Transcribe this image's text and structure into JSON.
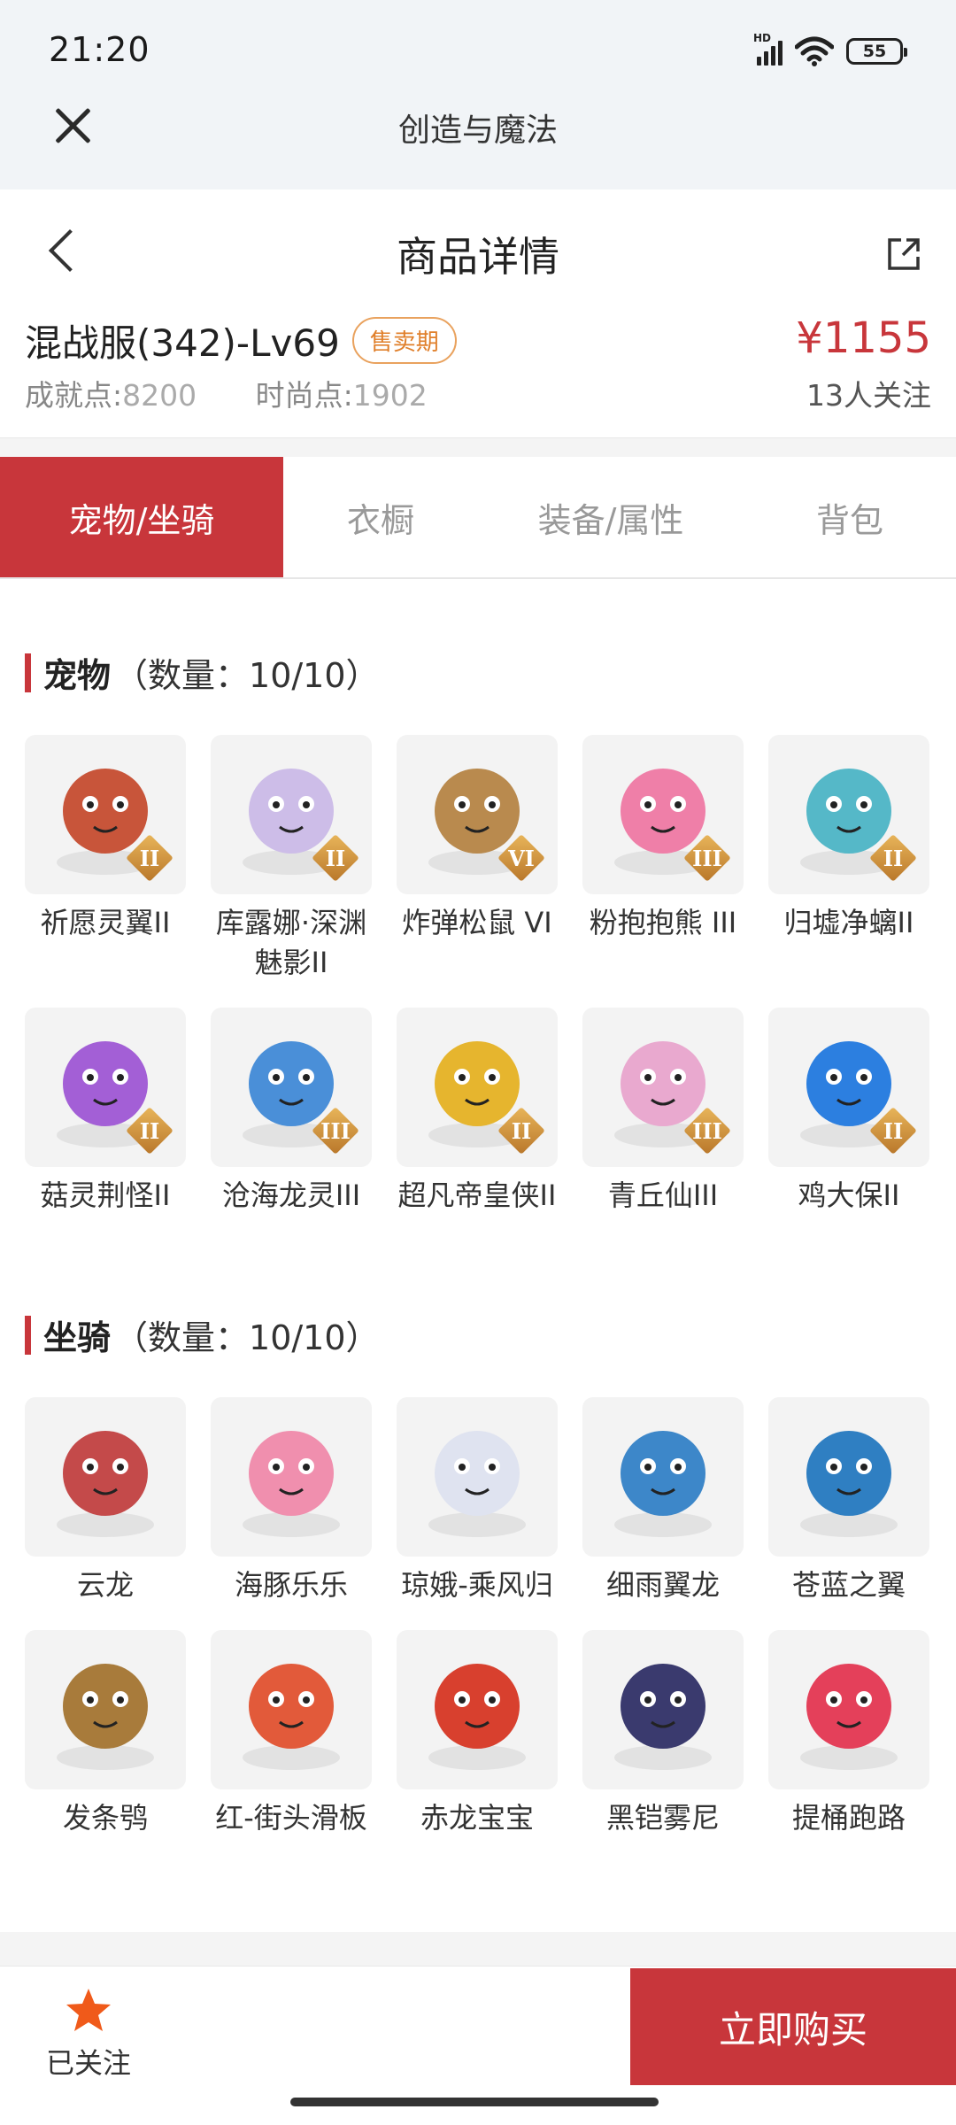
{
  "status_bar": {
    "time": "21:20",
    "network": "HD",
    "battery": "55"
  },
  "app_bar": {
    "title": "创造与魔法"
  },
  "header": {
    "title": "商品详情",
    "item_name": "混战服(342)-Lv69",
    "badge": "售卖期",
    "achievement_label": "成就点:",
    "achievement_value": "8200",
    "fashion_label": "时尚点:",
    "fashion_value": "1902",
    "price": "¥1155",
    "followers": "13人关注"
  },
  "tabs": [
    {
      "label": "宠物/坐骑",
      "active": true
    },
    {
      "label": "衣橱",
      "active": false
    },
    {
      "label": "装备/属性",
      "active": false
    },
    {
      "label": "背包",
      "active": false
    }
  ],
  "pets": {
    "title": "宠物",
    "count": "（数量：10/10）",
    "items": [
      {
        "name": "祈愿灵翼II",
        "level": "II",
        "color": "#c8553a"
      },
      {
        "name": "库露娜·深渊魅影II",
        "level": "II",
        "color": "#cdbde8"
      },
      {
        "name": "炸弹松鼠 VI",
        "level": "VI",
        "color": "#b98a4e"
      },
      {
        "name": "粉抱抱熊 III",
        "level": "III",
        "color": "#ef7fa8"
      },
      {
        "name": "归墟净螭II",
        "level": "II",
        "color": "#55b8c8"
      },
      {
        "name": "菇灵荆怪II",
        "level": "II",
        "color": "#a35fd6"
      },
      {
        "name": "沧海龙灵III",
        "level": "III",
        "color": "#4a8fd8"
      },
      {
        "name": "超凡帝皇侠II",
        "level": "II",
        "color": "#e6b52e"
      },
      {
        "name": "青丘仙III",
        "level": "III",
        "color": "#e9a9cf"
      },
      {
        "name": "鸡大保II",
        "level": "II",
        "color": "#2c7fe0"
      }
    ]
  },
  "mounts": {
    "title": "坐骑",
    "count": "（数量：10/10）",
    "items": [
      {
        "name": "云龙",
        "color": "#c44a4a"
      },
      {
        "name": "海豚乐乐",
        "color": "#f08fae"
      },
      {
        "name": "琼娥-乘风归",
        "color": "#dfe3f0"
      },
      {
        "name": "细雨翼龙",
        "color": "#3d87c9"
      },
      {
        "name": "苍蓝之翼",
        "color": "#2f7fc2"
      },
      {
        "name": "发条鸮",
        "color": "#a87b3b"
      },
      {
        "name": "红-街头滑板",
        "color": "#e25a3a"
      },
      {
        "name": "赤龙宝宝",
        "color": "#d8402e"
      },
      {
        "name": "黑铠雾尼",
        "color": "#3a3a6e"
      },
      {
        "name": "提桶跑路",
        "color": "#e4405a"
      }
    ]
  },
  "bottom": {
    "follow_label": "已关注",
    "buy_label": "立即购买"
  },
  "colors": {
    "accent": "#c8363b",
    "badge": "#e07f2a",
    "star": "#f05a1a"
  }
}
